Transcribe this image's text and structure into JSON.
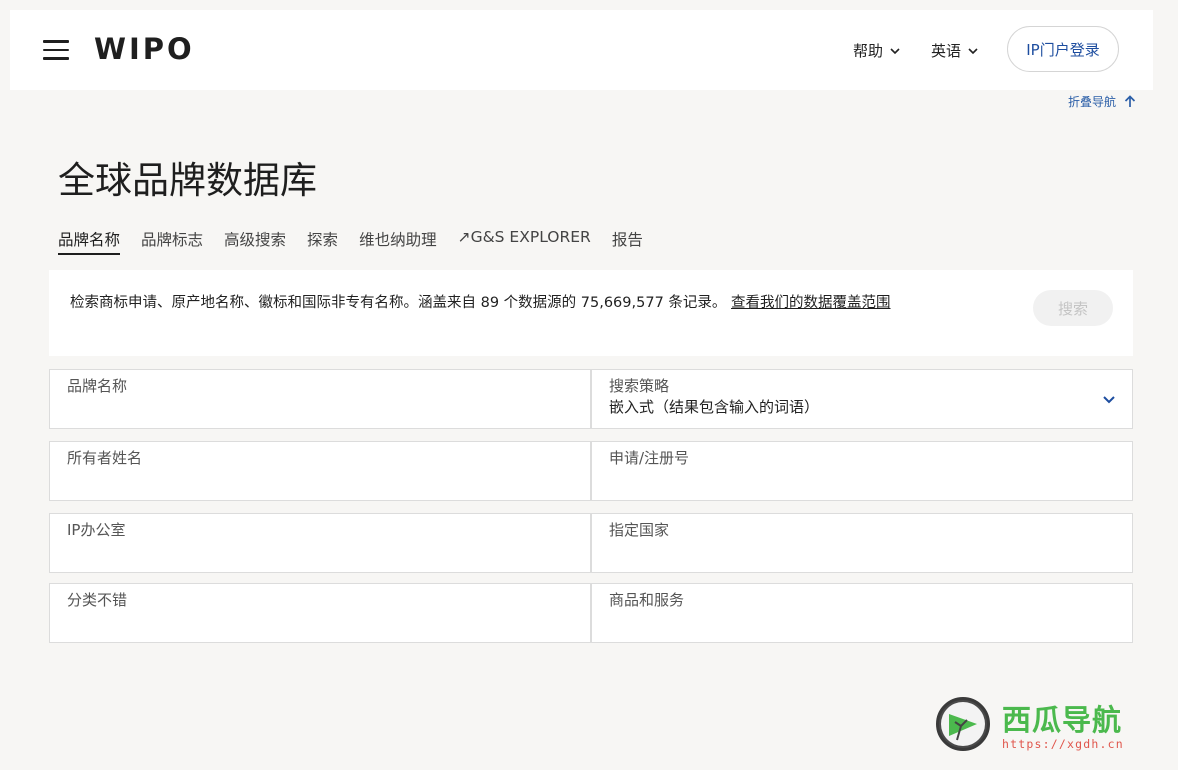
{
  "header": {
    "logo": "WIPO",
    "help_label": "帮助",
    "language_label": "英语",
    "login_label": "IP门户登录"
  },
  "collapse_nav_label": "折叠导航",
  "page_title": "全球品牌数据库",
  "tabs": [
    {
      "label": "品牌名称",
      "active": true
    },
    {
      "label": "品牌标志"
    },
    {
      "label": "高级搜索"
    },
    {
      "label": "探索"
    },
    {
      "label": "维也纳助理"
    },
    {
      "label": "↗G&S EXPLORER"
    },
    {
      "label": "报告"
    }
  ],
  "info": {
    "text": "检索商标申请、原产地名称、徽标和国际非专有名称。涵盖来自 89 个数据源的 75,669,577 条记录。",
    "link_label": "查看我们的数据覆盖范围",
    "search_label": "搜索"
  },
  "form": {
    "brand_name_label": "品牌名称",
    "strategy_label": "搜索策略",
    "strategy_value": "嵌入式（结果包含输入的词语）",
    "owner_label": "所有者姓名",
    "app_reg_label": "申请/注册号",
    "ip_office_label": "IP办公室",
    "designated_country_label": "指定国家",
    "classification_label": "分类不错",
    "goods_services_label": "商品和服务"
  },
  "watermark": {
    "title": "西瓜导航",
    "url": "https://xgdh.cn"
  },
  "colors": {
    "accent": "#1d4d9f",
    "background": "#f7f6f4",
    "watermark_green": "#4bb94d"
  }
}
